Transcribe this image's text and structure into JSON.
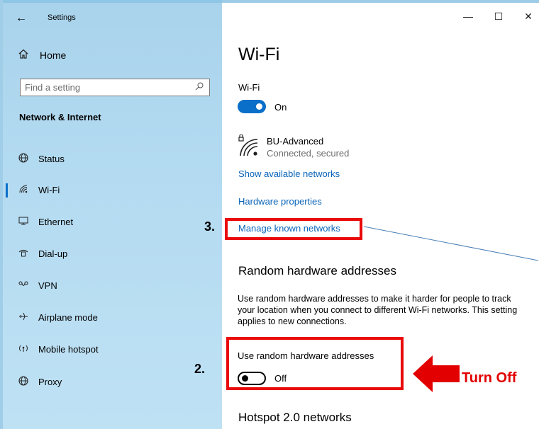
{
  "window": {
    "title": "Settings",
    "back_glyph": "←",
    "minimize_glyph": "—",
    "maximize_glyph": "☐",
    "close_glyph": "✕"
  },
  "sidebar": {
    "home_label": "Home",
    "search_placeholder": "Find a setting",
    "section_title": "Network & Internet",
    "items": [
      {
        "label": "Status",
        "icon": "globe-icon",
        "selected": false
      },
      {
        "label": "Wi-Fi",
        "icon": "wifi-icon",
        "selected": true
      },
      {
        "label": "Ethernet",
        "icon": "ethernet-icon",
        "selected": false
      },
      {
        "label": "Dial-up",
        "icon": "phone-icon",
        "selected": false
      },
      {
        "label": "VPN",
        "icon": "vpn-icon",
        "selected": false
      },
      {
        "label": "Airplane mode",
        "icon": "airplane-icon",
        "selected": false
      },
      {
        "label": "Mobile hotspot",
        "icon": "hotspot-icon",
        "selected": false
      },
      {
        "label": "Proxy",
        "icon": "globe-icon",
        "selected": false
      }
    ]
  },
  "main": {
    "title": "Wi-Fi",
    "wifi_label": "Wi-Fi",
    "wifi_state": "On",
    "network_name": "BU-Advanced",
    "network_status": "Connected, secured",
    "show_networks_link": "Show available networks",
    "hardware_props_link": "Hardware properties",
    "manage_networks_link": "Manage known networks",
    "random_hw_title": "Random hardware addresses",
    "random_hw_desc": "Use random hardware addresses to make it harder for people to track your location when you connect to different Wi-Fi networks. This setting applies to new connections.",
    "random_hw_label": "Use random hardware addresses",
    "random_hw_state": "Off",
    "hotspot_title": "Hotspot 2.0 networks"
  },
  "annotations": {
    "step3": "3.",
    "step2": "2.",
    "callout": "Turn Off",
    "highlight_color": "#ea0a0a",
    "accent_color": "#0a6fc9"
  }
}
